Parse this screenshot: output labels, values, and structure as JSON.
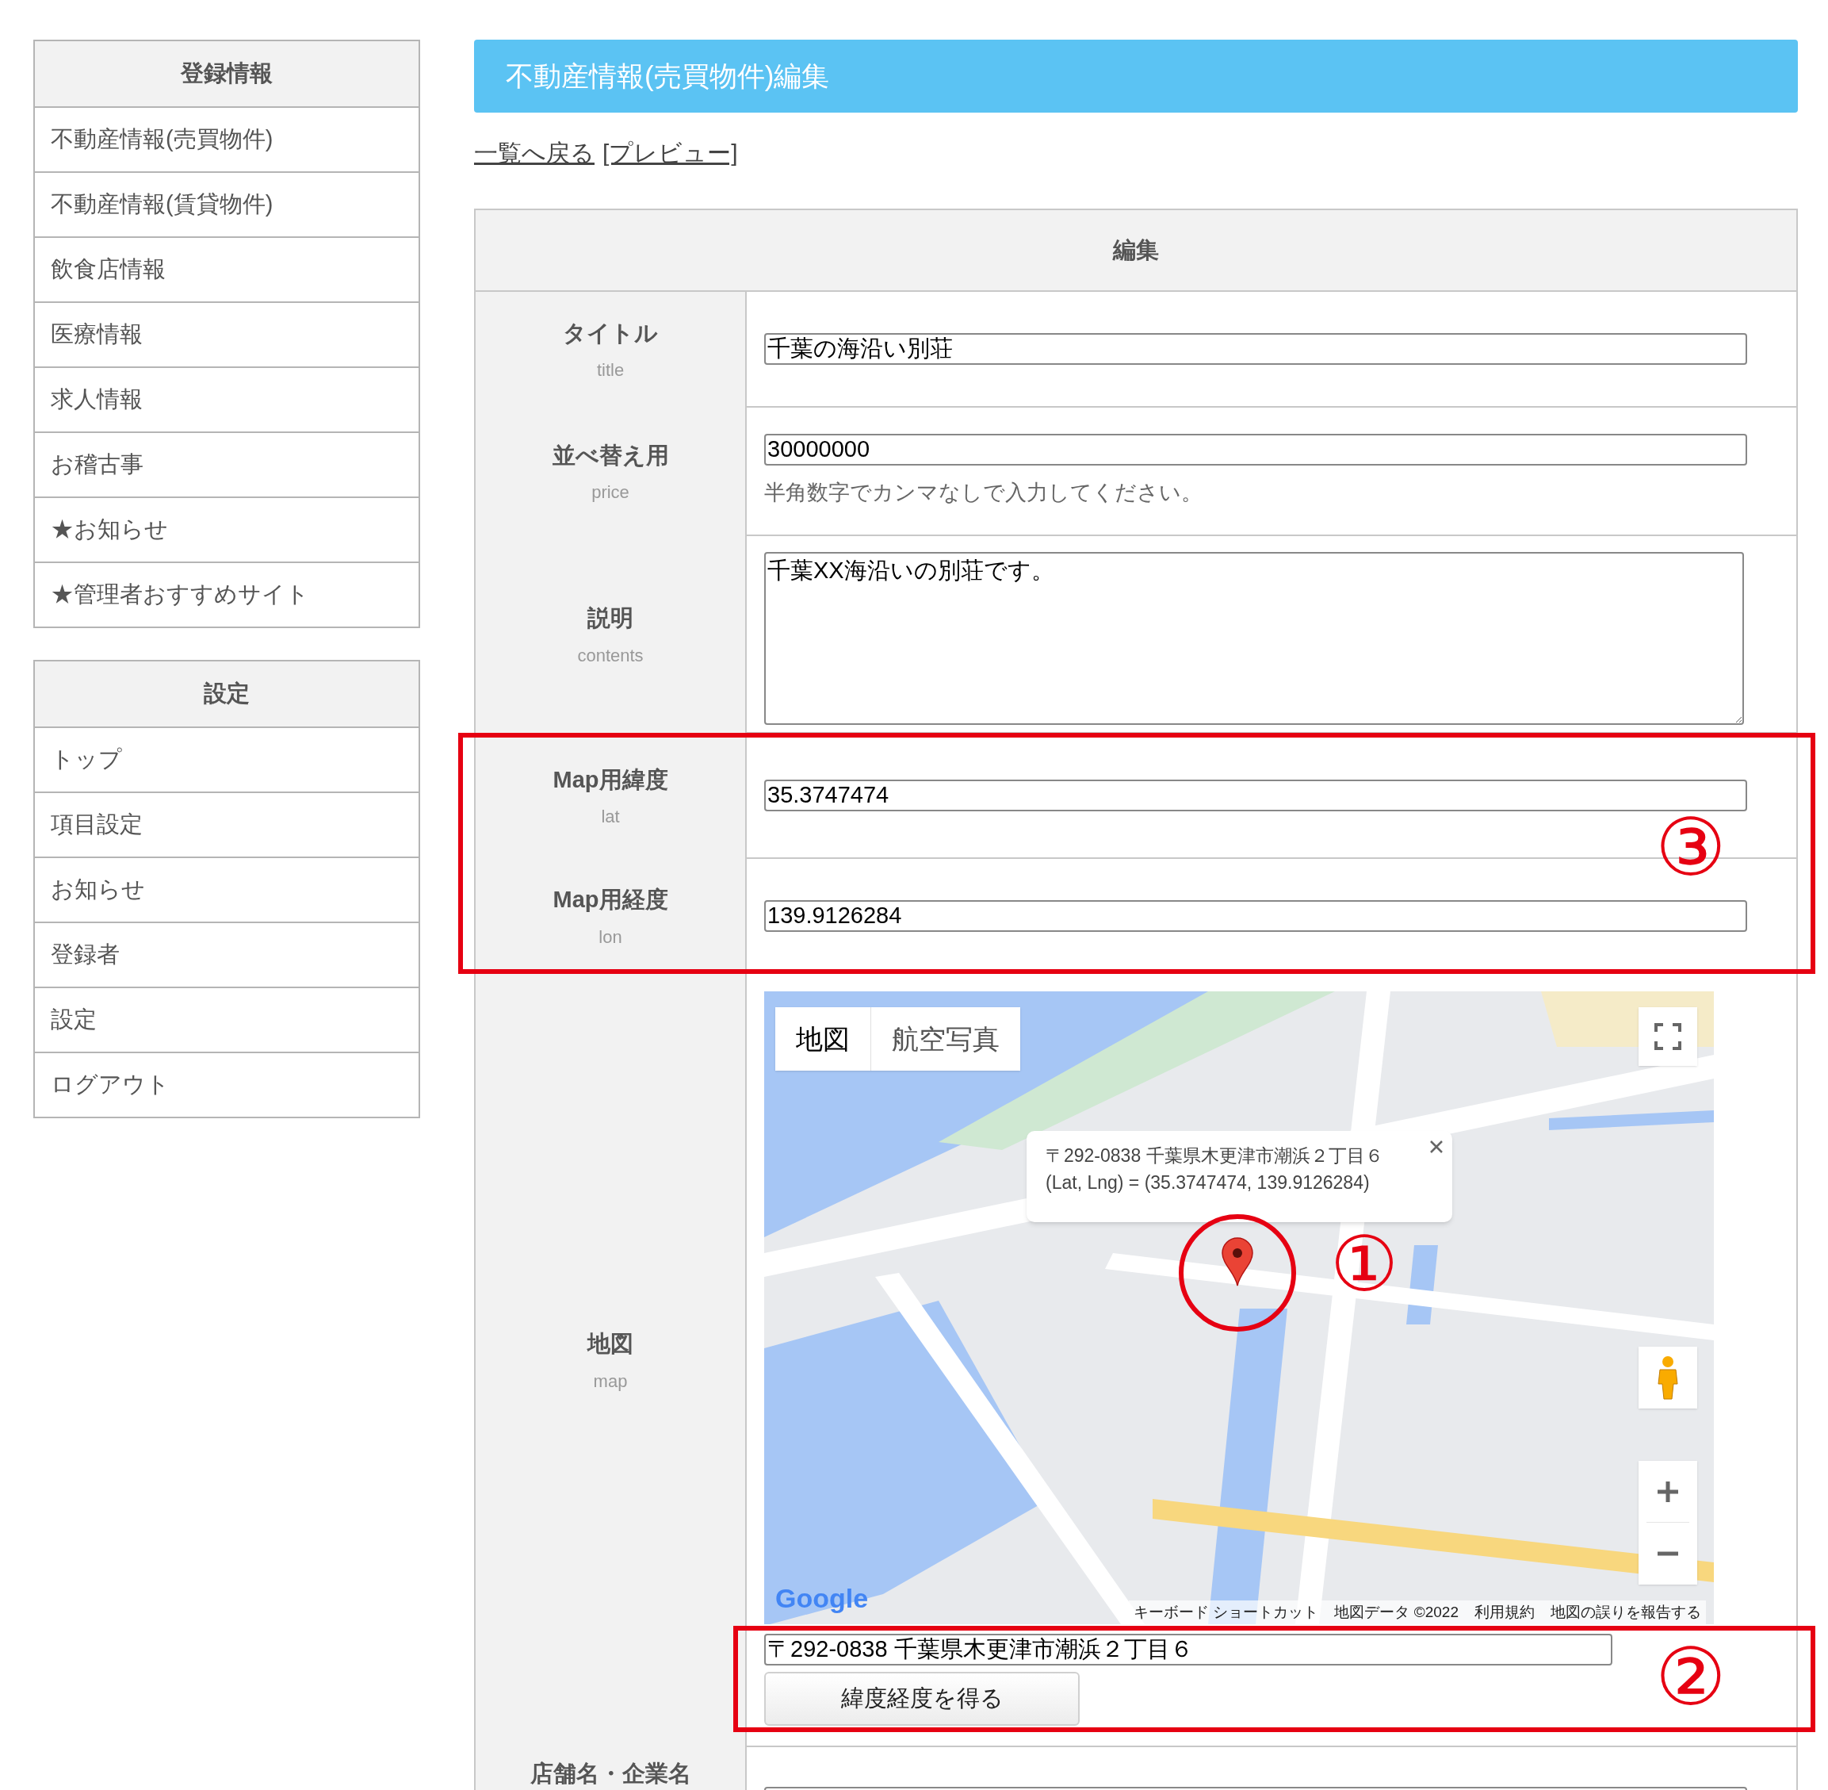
{
  "sidebar": [
    {
      "heading": "登録情報",
      "items": [
        "不動産情報(売買物件)",
        "不動産情報(賃貸物件)",
        "飲食店情報",
        "医療情報",
        "求人情報",
        "お稽古事",
        "★お知らせ",
        "★管理者おすすめサイト"
      ]
    },
    {
      "heading": "設定",
      "items": [
        "トップ",
        "項目設定",
        "お知らせ",
        "登録者",
        "設定",
        "ログアウト"
      ]
    }
  ],
  "page_title": "不動産情報(売買物件)編集",
  "links": [
    "一覧へ戻る",
    "[プレビュー]"
  ],
  "form": {
    "heading": "編集",
    "rows": [
      {
        "kind": "text",
        "label": "タイトル",
        "key": "title",
        "value": "千葉の海沿い別荘"
      },
      {
        "kind": "text",
        "label": "並べ替え用",
        "key": "price",
        "value": "30000000",
        "help": "半角数字でカンマなしで入力してください。"
      },
      {
        "kind": "textarea",
        "label": "説明",
        "key": "contents",
        "value": "千葉XX海沿いの別荘です。"
      },
      {
        "kind": "text",
        "label": "Map用緯度",
        "key": "lat",
        "value": "35.3747474"
      },
      {
        "kind": "text",
        "label": "Map用経度",
        "key": "lon",
        "value": "139.9126284"
      },
      {
        "kind": "map",
        "label": "地図",
        "key": "map",
        "map": {
          "map_types": [
            {
              "label": "地図",
              "selected": true
            },
            {
              "label": "航空写真",
              "selected": false
            }
          ],
          "info_window": [
            "〒292-0838 千葉県木更津市潮浜２丁目６",
            "(Lat, Lng) = (35.3747474, 139.9126284)"
          ],
          "marker_annotation": "①",
          "logo": "Google",
          "attribution": [
            "キーボード ショートカット",
            "地図データ ©2022",
            "利用規約",
            "地図の誤りを報告する"
          ]
        },
        "address": "〒292-0838 千葉県木更津市潮浜２丁目６",
        "button": "緯度経度を得る"
      },
      {
        "kind": "cut",
        "label": "店舗名・企業名"
      }
    ]
  },
  "annotations": [
    {
      "kind": "latlon",
      "mark": "③"
    },
    {
      "kind": "address",
      "mark": "②"
    }
  ]
}
